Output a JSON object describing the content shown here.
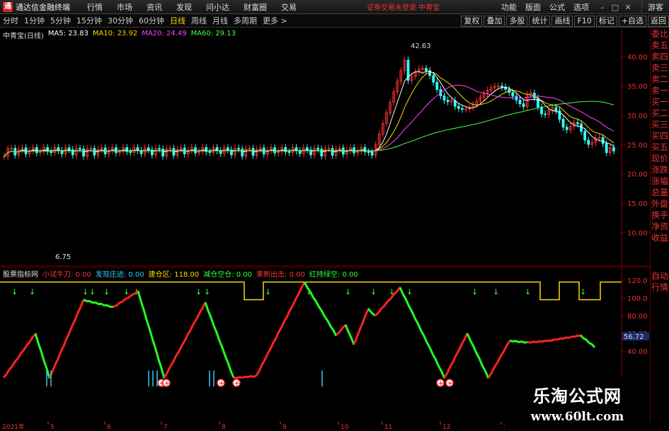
{
  "menubar": {
    "app_title": "通达信金融终端",
    "items": [
      "行情",
      "市场",
      "资讯",
      "发现",
      "问小达",
      "财富圈",
      "交易"
    ],
    "alert": "证券交易未登录 中青宝",
    "right_items": [
      "功能",
      "版面",
      "公式",
      "选项"
    ],
    "guest": "游客"
  },
  "period_bar": {
    "periods": [
      "分时",
      "1分钟",
      "5分钟",
      "15分钟",
      "30分钟",
      "60分钟",
      "日线",
      "周线",
      "月线",
      "多周期"
    ],
    "active": "日线",
    "more": "更多 >",
    "tools": [
      "复权",
      "叠加",
      "多股",
      "统计",
      "画线",
      "F10",
      "标记",
      "+自选",
      "返回"
    ]
  },
  "main_chart": {
    "stock": "中青宝(日线)",
    "ma": [
      {
        "label": "MA5: 23.83",
        "color": "#ffffff"
      },
      {
        "label": "MA10: 23.92",
        "color": "#ffd700"
      },
      {
        "label": "MA20: 24.49",
        "color": "#ff44ff"
      },
      {
        "label": "MA60: 29.13",
        "color": "#44ff44"
      }
    ],
    "high_label": "42.63",
    "low_label": "6.75",
    "y_ticks": [
      "40.00",
      "35.00",
      "30.00",
      "25.00",
      "20.00",
      "15.00",
      "10.00"
    ]
  },
  "indicator": {
    "name": "股票指标网",
    "fields": [
      {
        "label": "小试牛刀: 0.00",
        "color": "#ff3333"
      },
      {
        "label": "发现庄迹: 0.00",
        "color": "#33ccff"
      },
      {
        "label": "建仓区: 118.00",
        "color": "#ffd700"
      },
      {
        "label": "减仓空仓: 0.00",
        "color": "#33ff33"
      },
      {
        "label": "果断出击: 0.00",
        "color": "#ff3333"
      },
      {
        "label": "红持绿空: 0.00",
        "color": "#33ff33"
      }
    ],
    "y_ticks": [
      "120.0",
      "100.0",
      "80.00",
      "60.00",
      "40.00"
    ],
    "current": "56.72"
  },
  "date_axis": {
    "year": "2021年",
    "months": [
      "5",
      "6",
      "7",
      "8",
      "9",
      "10",
      "11",
      "12",
      "1"
    ]
  },
  "side_panel": {
    "items": [
      "委比",
      "卖五",
      "卖四",
      "卖三",
      "卖二",
      "卖一",
      "买一",
      "买二",
      "买三",
      "买四",
      "买五",
      "现价",
      "涨跌",
      "涨幅",
      "总量",
      "外盘",
      "换手",
      "净资",
      "收益"
    ],
    "bottom": [
      "自动",
      "行情"
    ]
  },
  "watermark": {
    "cn": "乐淘公式网",
    "url": "www.60lt.com"
  },
  "colors": {
    "up": "#ff3333",
    "down": "#33ffff",
    "axis": "#8b0000"
  }
}
